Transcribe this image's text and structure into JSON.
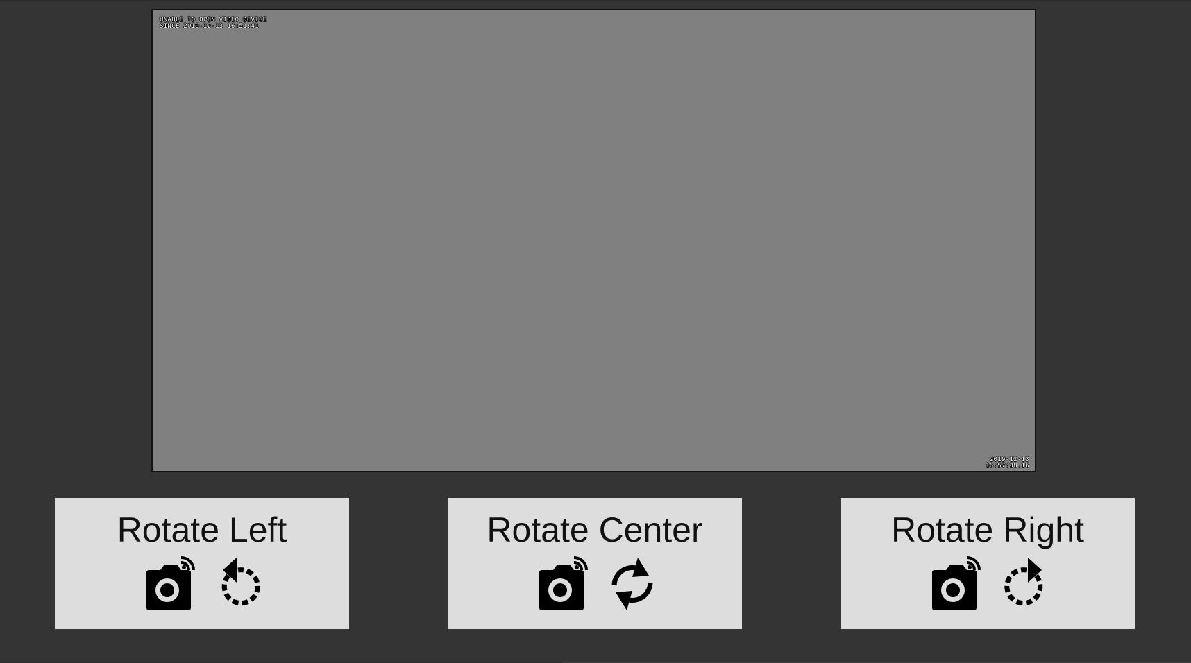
{
  "video": {
    "error_line_1": "UNABLE TO OPEN VIDEO DEVICE",
    "error_line_2": "SINCE 2019-12-13 16:51:41",
    "date": "2019-12-13",
    "time": "16:57:38.16"
  },
  "controls": [
    {
      "label": "Rotate Left",
      "camera_icon": "remote-camera-icon",
      "action_icon": "rotate-left-icon"
    },
    {
      "label": "Rotate Center",
      "camera_icon": "remote-camera-icon",
      "action_icon": "sync-icon"
    },
    {
      "label": "Rotate Right",
      "camera_icon": "remote-camera-icon",
      "action_icon": "rotate-right-icon"
    }
  ],
  "colors": {
    "background": "#343434",
    "video_placeholder": "#808080",
    "button_background": "#dddddd",
    "text": "#111111"
  }
}
